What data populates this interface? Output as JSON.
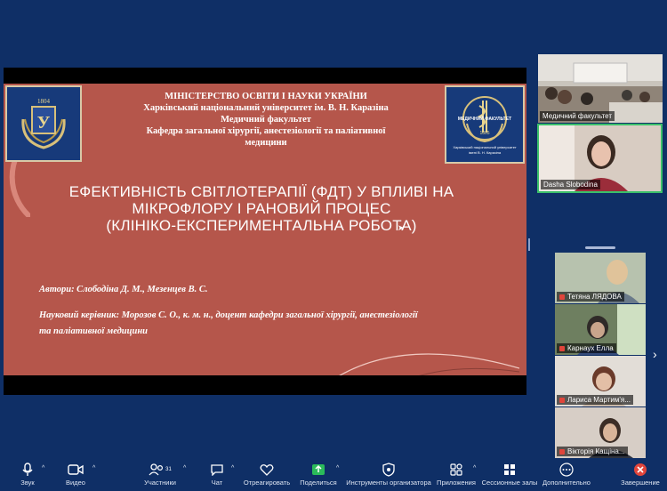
{
  "slide": {
    "header": [
      "МІНІСТЕРСТВО ОСВІТИ І НАУКИ УКРАЇНИ",
      "Харківський національний університет  ім. В. Н. Каразіна",
      "Медичний факультет",
      "Кафедра загальної хірургії, анестезіології та паліативної",
      "медицини"
    ],
    "title": [
      "ЕФЕКТИВНІСТЬ СВІТЛОТЕРАПІЇ (ФДТ) У ВПЛИВІ НА",
      "МІКРОФЛОРУ І РАНОВИЙ ПРОЦЕС",
      "(КЛІНІКО-ЕКСПЕРИМЕНТАЛЬНА РОБОТА)"
    ],
    "authors": "Автори:  Слободіна Д. М., Мезенцев В. С.",
    "supervisor_line1": "Науковий керівник: Морозов С. О., к. м. н., доцент кафедри загальної хірургії, анестезіології",
    "supervisor_line2": "та паліативної медицини",
    "logo_left_year": "1804",
    "logo_right_text": "МЕДИЧНИЙ ФАКУЛЬТЕТ",
    "logo_right_year": "1805",
    "logo_right_caption1": "Харківський національний університет",
    "logo_right_caption2": "імені В. Н. Каразіна"
  },
  "participants_top": [
    {
      "name": "Медичний факультет",
      "muted": false
    },
    {
      "name": "Dasha Slobodina",
      "muted": false
    }
  ],
  "participants_side": [
    {
      "name": "Тетяна ЛЯДОВА",
      "muted": true
    },
    {
      "name": "Карнаух Елла",
      "muted": true
    },
    {
      "name": "Лариса Мартим'я...",
      "muted": true
    },
    {
      "name": "Вікторія Кащіна...",
      "muted": true
    }
  ],
  "toolbar": {
    "audio": "Звук",
    "video": "Видео",
    "participants": "Участники",
    "participants_count": "31",
    "chat": "Чат",
    "react": "Отреагировать",
    "share": "Поделиться",
    "host_tools": "Инструменты организатора",
    "apps": "Приложения",
    "breakout": "Сессионные залы",
    "more": "Дополнительно",
    "end": "Завершение"
  },
  "colors": {
    "background": "#0f2f66",
    "slide": "#b5564b",
    "logo_box": "#173a7a",
    "share_green": "#2bbb5a",
    "end_red": "#e0453b",
    "active_border": "#3bc06a"
  }
}
